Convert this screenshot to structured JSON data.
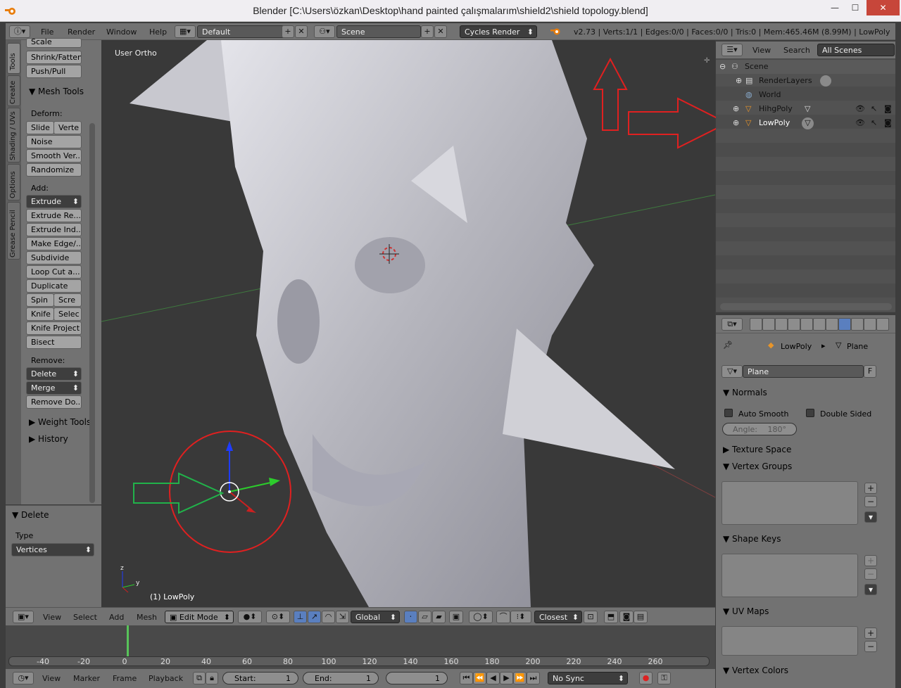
{
  "window": {
    "title": "Blender [C:\\Users\\özkan\\Desktop\\hand painted çalışmalarım\\shield2\\shield topology.blend]",
    "min": "—",
    "max": "☐",
    "close": "✕"
  },
  "topbar": {
    "menus": [
      "File",
      "Render",
      "Window",
      "Help"
    ],
    "layout": "Default",
    "scene": "Scene",
    "engine": "Cycles Render",
    "stats": "v2.73 | Verts:1/1 | Edges:0/0 | Faces:0/0 | Tris:0 | Mem:465.46M (8.99M) | LowPoly"
  },
  "tabs": [
    "Tools",
    "Create",
    "Shading / UVs",
    "Options",
    "Grease Pencil"
  ],
  "tools": {
    "top": [
      "Scale",
      "Shrink/Fatten",
      "Push/Pull"
    ],
    "mesh_tools": "Mesh Tools",
    "deform_label": "Deform:",
    "slide": "Slide",
    "vertex": "Verte",
    "noise": "Noise",
    "smooth": "Smooth Ver...",
    "randomize": "Randomize",
    "add_label": "Add:",
    "extrude": "Extrude",
    "extrude_region": "Extrude Re...",
    "extrude_indiv": "Extrude Ind...",
    "make_edge": "Make Edge/...",
    "subdivide": "Subdivide",
    "loopcut": "Loop Cut a...",
    "duplicate": "Duplicate",
    "spin": "Spin",
    "screw": "Scre",
    "knife": "Knife",
    "select": "Selec",
    "knife_project": "Knife Project",
    "bisect": "Bisect",
    "remove_label": "Remove:",
    "delete": "Delete",
    "merge": "Merge",
    "remove_doubles": "Remove Do...",
    "weight_tools": "Weight Tools",
    "history": "History"
  },
  "operator": {
    "title": "Delete",
    "type_label": "Type",
    "type_value": "Vertices"
  },
  "viewport": {
    "view_name": "User Ortho",
    "object_label": "(1) LowPoly"
  },
  "viewport_header": {
    "menus": [
      "View",
      "Select",
      "Add",
      "Mesh"
    ],
    "mode": "Edit Mode",
    "orientation": "Global",
    "snap": "Closest"
  },
  "timeline": {
    "ticks": [
      "-40",
      "-20",
      "0",
      "20",
      "40",
      "60",
      "80",
      "100",
      "120",
      "140",
      "160",
      "180",
      "200",
      "220",
      "240",
      "260"
    ],
    "menus": [
      "View",
      "Marker",
      "Frame",
      "Playback"
    ],
    "start_label": "Start:",
    "start": "1",
    "end_label": "End:",
    "end": "1",
    "current": "1",
    "sync": "No Sync"
  },
  "outliner": {
    "menus": [
      "View",
      "Search"
    ],
    "filter": "All Scenes",
    "rows": [
      {
        "label": "Scene"
      },
      {
        "label": "RenderLayers"
      },
      {
        "label": "World"
      },
      {
        "label": "HihgPoly"
      },
      {
        "label": "LowPoly"
      }
    ]
  },
  "properties": {
    "breadcrumb_object": "LowPoly",
    "breadcrumb_data": "Plane",
    "datablock": "Plane",
    "fake_user": "F",
    "normals": "Normals",
    "auto_smooth": "Auto Smooth",
    "double_sided": "Double Sided",
    "angle_label": "Angle:",
    "angle_value": "180°",
    "texture_space": "Texture Space",
    "vertex_groups": "Vertex Groups",
    "shape_keys": "Shape Keys",
    "uv_maps": "UV Maps",
    "vertex_colors": "Vertex Colors"
  },
  "colors": {
    "annotation_red": "#e02020",
    "annotation_green": "#21b24a",
    "axis_blue": "#1f3cff",
    "axis_green": "#2ccc2c",
    "axis_red": "#cc2020"
  }
}
